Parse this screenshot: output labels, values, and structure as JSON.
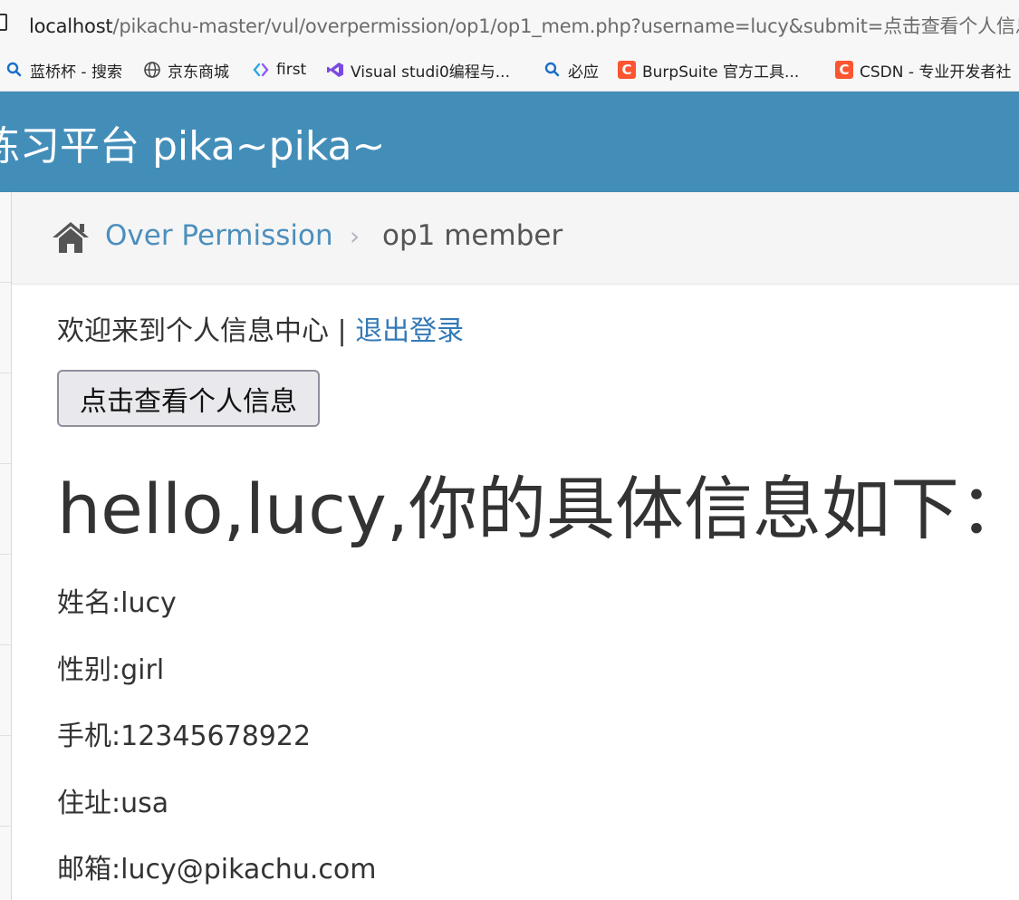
{
  "browser": {
    "url_host": "localhost",
    "url_path": "/pikachu-master/vul/overpermission/op1/op1_mem.php?username=lucy&submit=点击查看个人信息",
    "bookmarks": [
      {
        "label": "蓝桥杯 - 搜索",
        "icon": "search-icon"
      },
      {
        "label": "京东商城",
        "icon": "globe-icon"
      },
      {
        "label": "first",
        "icon": "code-icon"
      },
      {
        "label": "Visual studi0编程与...",
        "icon": "visual-studio-icon"
      },
      {
        "label": "必应",
        "icon": "search-icon"
      },
      {
        "label": "BurpSuite 官方工具...",
        "icon": "csdn-icon"
      },
      {
        "label": "CSDN - 专业开发者社",
        "icon": "csdn-icon"
      }
    ],
    "csdn_icon_letter": "C"
  },
  "header": {
    "title": "练习平台 pika~pika~"
  },
  "breadcrumb": {
    "parent": "Over Permission",
    "separator": "›",
    "current": "op1 member"
  },
  "main": {
    "welcome_text": "欢迎来到个人信息中心 | ",
    "logout_label": "退出登录",
    "view_button_label": "点击查看个人信息",
    "greeting": "hello,lucy,你的具体信息如下：",
    "info": [
      {
        "label": "姓名:",
        "value": "lucy"
      },
      {
        "label": "性别:",
        "value": "girl"
      },
      {
        "label": "手机:",
        "value": "12345678922"
      },
      {
        "label": "住址:",
        "value": "usa"
      },
      {
        "label": "邮箱:",
        "value": "lucy@pikachu.com"
      }
    ]
  },
  "colors": {
    "header_bg": "#438eb9",
    "link": "#4c8fbd",
    "csdn": "#fc5531"
  }
}
